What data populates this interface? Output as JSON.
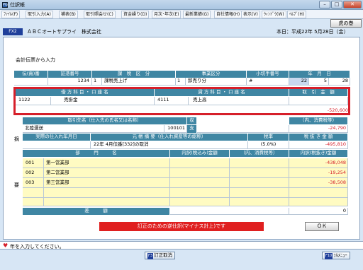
{
  "window": {
    "title": "仕訳帳",
    "icon_label": "PG"
  },
  "menu": [
    "ﾌｧｲﾙ(F)",
    "取引入力(A)",
    "補表(B)",
    "取引照会せ(C)",
    "資金繰り(D)",
    "月次･年次(E)",
    "最新業績(G)",
    "自社情報(H)",
    "表示(V)",
    "ｳｨﾝﾄﾞｳ(W)",
    "ﾍﾙﾌﾟ(H)"
  ],
  "tora_button": "虎の巻",
  "fx_badge": "FX2",
  "company": "ＡＢＣオートサプライ　株式会社",
  "today": "本日：平成22年 5月28日（金）",
  "main_title": "会計伝票から入力",
  "header_row": [
    "伝(貢)番",
    "証憑番号",
    "課　税　区　分",
    "事業区分",
    "小切手番号",
    "年　月　日"
  ],
  "value_row": {
    "den": "",
    "shohyo": "1234",
    "kazei_code": "1",
    "kazei_name": "課税売上げ",
    "jigyo_code": "1",
    "jigyo_name": "卸売り分",
    "kogitte": "#",
    "year": "22",
    "month": "5",
    "day": "28"
  },
  "account_header": [
    "借 方 科 目 ・ 口 座 名",
    "貸 方 科 目 ・ 口 座 名",
    "取　引　金　額"
  ],
  "account_row": {
    "debit_code": "1122",
    "debit_name": "売掛金",
    "credit_code": "4111",
    "credit_name": "売上高",
    "amount": "-520,600"
  },
  "partner_header": [
    "取引先名（仕入先の氏名又は名称）",
    "収",
    "（内、消費税等）"
  ],
  "partner_row": {
    "name": "北陸運送",
    "code": "100101",
    "kind": "支",
    "tax": "-24,790"
  },
  "kijitsu_header": [
    "実際の仕入れ年月日",
    "元 帳 摘 要（仕入れ資産等の総称）",
    "税率",
    "税 抜 き 金 額"
  ],
  "kijitsu_row": {
    "date": "",
    "summary": "22年 4月伝番[332]の取消",
    "rate": "(5.0%)",
    "net": "-495,810"
  },
  "side_labels": [
    "摘",
    "要"
  ],
  "dept_header": [
    "部　　　門　　　名",
    "内訳(税込み)金額",
    "（内、消費税等）",
    "内訳(税抜き)金額"
  ],
  "dept_rows": [
    {
      "code": "001",
      "name": "第一営業部",
      "amount": "",
      "tax": "",
      "net": "-438,048"
    },
    {
      "code": "002",
      "name": "第二営業部",
      "amount": "",
      "tax": "",
      "net": "-19,254"
    },
    {
      "code": "003",
      "name": "第三営業部",
      "amount": "",
      "tax": "",
      "net": "-38,508"
    },
    {
      "code": "",
      "name": "",
      "amount": "",
      "tax": "",
      "net": ""
    },
    {
      "code": "",
      "name": "",
      "amount": "",
      "tax": "",
      "net": ""
    }
  ],
  "sagaku": {
    "label": "差　　　額",
    "value": "0"
  },
  "warning": "訂正のための逆仕訳(マイナス計上)です",
  "ok_label": "ＯＫ",
  "status": "年を入力してください。",
  "f3": {
    "key": "F3",
    "label": "訂正取消"
  },
  "f10": {
    "key": "F10",
    "label": "ﾌﾙﾒﾆｭｰ"
  }
}
